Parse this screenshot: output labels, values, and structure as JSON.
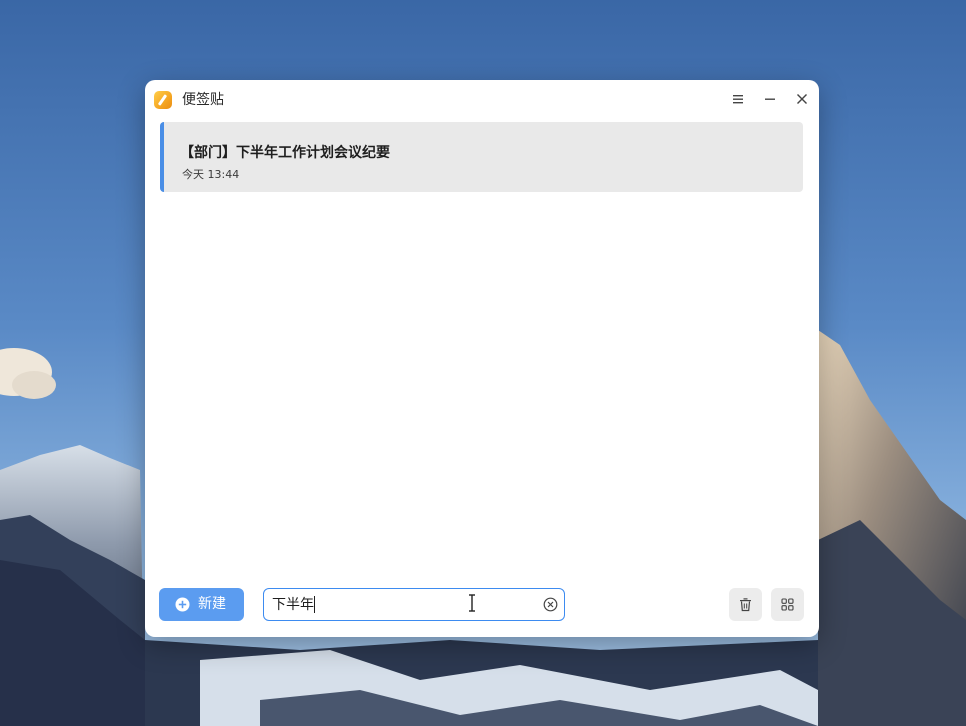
{
  "window": {
    "title": "便签贴",
    "icon": "notes-app-icon"
  },
  "titlebar_controls": [
    {
      "name": "menu-icon"
    },
    {
      "name": "minimize-icon"
    },
    {
      "name": "close-icon"
    }
  ],
  "notes": [
    {
      "title": "【部门】下半年工作计划会议纪要",
      "time": "今天  13:44",
      "selected": true
    }
  ],
  "bottom": {
    "new_label": "新建",
    "new_icon": "plus-circle-icon",
    "search_value": "下半年",
    "clear_icon": "clear-circle-icon",
    "delete_icon": "trash-icon",
    "view_icon": "grid-view-icon"
  },
  "colors": {
    "accent": "#5b9cf0",
    "note_accent": "#4a8ee6",
    "note_bg": "#e9e9e9",
    "app_icon": "#f5a623"
  }
}
